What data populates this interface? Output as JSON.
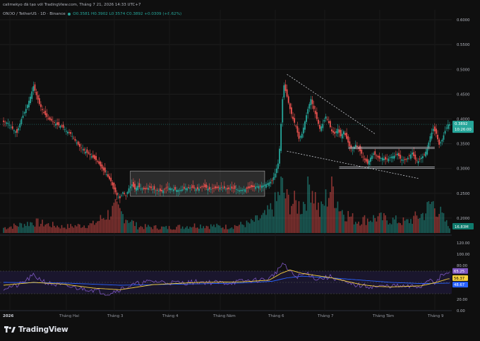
{
  "header": {
    "publisher": "calimekyo đã tạo với TradingView.com, Tháng 7 21, 2026 14:33 UTC+7"
  },
  "symbol": {
    "name": "ONDO / TetherUS · 1D · Binance",
    "ohlc": "O0.3581 H0.3902 L0.3574 C0.3892 +0.0309 (+8.62%)"
  },
  "price_axis": {
    "ticks": [
      "0.6000",
      "0.5500",
      "0.5000",
      "0.4500",
      "0.4000",
      "0.3500",
      "0.3000",
      "0.2500",
      "0.2000"
    ],
    "last_price_label": "0.3892",
    "countdown_label": "10:26:00",
    "volume_label": "16.83M"
  },
  "rsi_axis": {
    "ticks": [
      "120.00",
      "100.00",
      "80.00",
      "60.00",
      "40.00",
      "20.00",
      "0.00"
    ],
    "rsi_label": "65.25",
    "ma_label": "56.37",
    "low_label": "48.67"
  },
  "time_axis": {
    "ticks": [
      "2026",
      "Tháng Hai",
      "Tháng 3",
      "Tháng 4",
      "Tháng Năm",
      "Tháng 6",
      "Tháng 7",
      "Tháng Tám",
      "Tháng 9"
    ]
  },
  "colors": {
    "up": "#26a69a",
    "down": "#ef5350",
    "rsi": "#7e57c2",
    "rsi_ma": "#f7d23c",
    "rsi_long": "#2962ff",
    "band": "#1c1733"
  },
  "brand": {
    "logo_text": "TradingView"
  },
  "chart_data": {
    "type": "candlestick",
    "symbol": "ONDO / TetherUS",
    "timeframe": "1D",
    "exchange": "Binance",
    "last": {
      "open": 0.3581,
      "high": 0.3902,
      "low": 0.3574,
      "close": 0.3892,
      "change": 0.0309,
      "change_pct": 8.62
    },
    "price_ylim": [
      0.17,
      0.62
    ],
    "price_grid": [
      0.6,
      0.55,
      0.5,
      0.45,
      0.4,
      0.35,
      0.3,
      0.25,
      0.2
    ],
    "close_path": [
      [
        0,
        0.394
      ],
      [
        3,
        0.392
      ],
      [
        6,
        0.38
      ],
      [
        9,
        0.372
      ],
      [
        12,
        0.4
      ],
      [
        15,
        0.42
      ],
      [
        18,
        0.445
      ],
      [
        20,
        0.466
      ],
      [
        22,
        0.448
      ],
      [
        24,
        0.43
      ],
      [
        27,
        0.412
      ],
      [
        30,
        0.4
      ],
      [
        33,
        0.395
      ],
      [
        36,
        0.388
      ],
      [
        39,
        0.385
      ],
      [
        42,
        0.376
      ],
      [
        45,
        0.37
      ],
      [
        48,
        0.356
      ],
      [
        51,
        0.344
      ],
      [
        54,
        0.336
      ],
      [
        57,
        0.33
      ],
      [
        60,
        0.322
      ],
      [
        63,
        0.314
      ],
      [
        66,
        0.3
      ],
      [
        69,
        0.288
      ],
      [
        72,
        0.274
      ],
      [
        74,
        0.258
      ],
      [
        76,
        0.246
      ],
      [
        78,
        0.24
      ],
      [
        80,
        0.252
      ],
      [
        82,
        0.245
      ],
      [
        84,
        0.26
      ],
      [
        86,
        0.268
      ],
      [
        88,
        0.258
      ],
      [
        90,
        0.265
      ],
      [
        92,
        0.26
      ],
      [
        95,
        0.258
      ],
      [
        98,
        0.262
      ],
      [
        102,
        0.256
      ],
      [
        106,
        0.254
      ],
      [
        110,
        0.262
      ],
      [
        114,
        0.258
      ],
      [
        118,
        0.256
      ],
      [
        122,
        0.26
      ],
      [
        126,
        0.262
      ],
      [
        130,
        0.258
      ],
      [
        134,
        0.264
      ],
      [
        138,
        0.258
      ],
      [
        142,
        0.26
      ],
      [
        146,
        0.262
      ],
      [
        150,
        0.258
      ],
      [
        154,
        0.26
      ],
      [
        158,
        0.256
      ],
      [
        162,
        0.258
      ],
      [
        166,
        0.262
      ],
      [
        170,
        0.264
      ],
      [
        174,
        0.266
      ],
      [
        177,
        0.27
      ],
      [
        180,
        0.275
      ],
      [
        182,
        0.29
      ],
      [
        184,
        0.31
      ],
      [
        185,
        0.34
      ],
      [
        186,
        0.39
      ],
      [
        187,
        0.44
      ],
      [
        188,
        0.468
      ],
      [
        190,
        0.445
      ],
      [
        192,
        0.42
      ],
      [
        194,
        0.4
      ],
      [
        196,
        0.385
      ],
      [
        198,
        0.36
      ],
      [
        200,
        0.37
      ],
      [
        202,
        0.395
      ],
      [
        204,
        0.42
      ],
      [
        206,
        0.44
      ],
      [
        208,
        0.42
      ],
      [
        210,
        0.4
      ],
      [
        212,
        0.38
      ],
      [
        214,
        0.39
      ],
      [
        216,
        0.405
      ],
      [
        218,
        0.392
      ],
      [
        220,
        0.375
      ],
      [
        222,
        0.37
      ],
      [
        224,
        0.38
      ],
      [
        226,
        0.365
      ],
      [
        228,
        0.375
      ],
      [
        230,
        0.36
      ],
      [
        232,
        0.345
      ],
      [
        234,
        0.338
      ],
      [
        236,
        0.348
      ],
      [
        238,
        0.34
      ],
      [
        240,
        0.33
      ],
      [
        242,
        0.318
      ],
      [
        244,
        0.31
      ],
      [
        246,
        0.322
      ],
      [
        248,
        0.33
      ],
      [
        250,
        0.325
      ],
      [
        252,
        0.32
      ],
      [
        254,
        0.322
      ],
      [
        256,
        0.318
      ],
      [
        258,
        0.32
      ],
      [
        260,
        0.324
      ],
      [
        262,
        0.326
      ],
      [
        264,
        0.33
      ],
      [
        266,
        0.32
      ],
      [
        268,
        0.317
      ],
      [
        270,
        0.318
      ],
      [
        272,
        0.325
      ],
      [
        274,
        0.332
      ],
      [
        276,
        0.318
      ],
      [
        278,
        0.315
      ],
      [
        280,
        0.322
      ],
      [
        282,
        0.328
      ],
      [
        284,
        0.34
      ],
      [
        286,
        0.365
      ],
      [
        288,
        0.38
      ],
      [
        290,
        0.37
      ],
      [
        292,
        0.348
      ],
      [
        294,
        0.358
      ],
      [
        296,
        0.376
      ],
      [
        298,
        0.389
      ]
    ],
    "annotations": {
      "range_box": {
        "x": [
          85,
          175
        ],
        "y": [
          0.244,
          0.295
        ]
      },
      "resistance": {
        "x": [
          231,
          289
        ],
        "y": [
          0.343,
          0.343
        ]
      },
      "support": {
        "x": [
          225,
          289
        ],
        "y": [
          0.303,
          0.303
        ]
      },
      "upper_trendline": {
        "x": [
          190,
          249
        ],
        "y": [
          0.49,
          0.37
        ]
      },
      "lower_trendline": {
        "x": [
          190,
          278
        ],
        "y": [
          0.335,
          0.28
        ]
      }
    },
    "volume_millions": [
      [
        0,
        12
      ],
      [
        10,
        18
      ],
      [
        20,
        25
      ],
      [
        40,
        14
      ],
      [
        60,
        20
      ],
      [
        75,
        55
      ],
      [
        90,
        15
      ],
      [
        110,
        12
      ],
      [
        130,
        18
      ],
      [
        150,
        14
      ],
      [
        165,
        22
      ],
      [
        176,
        40
      ],
      [
        183,
        70
      ],
      [
        186,
        110
      ],
      [
        190,
        75
      ],
      [
        200,
        60
      ],
      [
        206,
        120
      ],
      [
        212,
        45
      ],
      [
        220,
        110
      ],
      [
        226,
        55
      ],
      [
        236,
        28
      ],
      [
        250,
        35
      ],
      [
        270,
        25
      ],
      [
        282,
        45
      ],
      [
        287,
        70
      ],
      [
        290,
        60
      ],
      [
        298,
        16.83
      ]
    ],
    "rsi": {
      "ylim": [
        0,
        120
      ],
      "levels": [
        70,
        50,
        30
      ],
      "ticks": [
        120,
        100,
        80,
        60,
        40,
        20,
        0
      ],
      "last_rsi": 65.25,
      "last_ma": 56.37,
      "last_long": 48.67,
      "rsi_path": [
        [
          0,
          40
        ],
        [
          10,
          45
        ],
        [
          20,
          62
        ],
        [
          30,
          48
        ],
        [
          40,
          44
        ],
        [
          50,
          40
        ],
        [
          60,
          37
        ],
        [
          70,
          30
        ],
        [
          78,
          38
        ],
        [
          90,
          48
        ],
        [
          100,
          52
        ],
        [
          110,
          50
        ],
        [
          120,
          49
        ],
        [
          130,
          51
        ],
        [
          140,
          50
        ],
        [
          150,
          49
        ],
        [
          160,
          52
        ],
        [
          170,
          54
        ],
        [
          178,
          56
        ],
        [
          184,
          72
        ],
        [
          187,
          84
        ],
        [
          190,
          74
        ],
        [
          196,
          60
        ],
        [
          204,
          66
        ],
        [
          210,
          56
        ],
        [
          220,
          60
        ],
        [
          230,
          48
        ],
        [
          240,
          44
        ],
        [
          250,
          42
        ],
        [
          260,
          44
        ],
        [
          270,
          42
        ],
        [
          280,
          43
        ],
        [
          286,
          58
        ],
        [
          290,
          48
        ],
        [
          294,
          64
        ],
        [
          298,
          65.25
        ]
      ],
      "ma_path": [
        [
          0,
          45
        ],
        [
          20,
          50
        ],
        [
          40,
          47
        ],
        [
          60,
          40
        ],
        [
          78,
          37
        ],
        [
          100,
          46
        ],
        [
          130,
          50
        ],
        [
          160,
          51
        ],
        [
          178,
          54
        ],
        [
          186,
          66
        ],
        [
          192,
          72
        ],
        [
          200,
          66
        ],
        [
          210,
          62
        ],
        [
          220,
          58
        ],
        [
          230,
          52
        ],
        [
          240,
          46
        ],
        [
          250,
          43
        ],
        [
          260,
          42
        ],
        [
          270,
          43
        ],
        [
          280,
          44
        ],
        [
          290,
          50
        ],
        [
          298,
          56.37
        ]
      ],
      "long_path": [
        [
          0,
          50
        ],
        [
          40,
          49
        ],
        [
          78,
          45
        ],
        [
          120,
          47
        ],
        [
          160,
          49
        ],
        [
          180,
          52
        ],
        [
          190,
          58
        ],
        [
          200,
          61
        ],
        [
          220,
          58
        ],
        [
          240,
          54
        ],
        [
          260,
          50
        ],
        [
          280,
          48
        ],
        [
          298,
          48.67
        ]
      ]
    },
    "xaxis_ticks": [
      "2026",
      "Tháng Hai",
      "Tháng 3",
      "Tháng 4",
      "Tháng Năm",
      "Tháng 6",
      "Tháng 7",
      "Tháng Tám",
      "Tháng 9"
    ]
  }
}
